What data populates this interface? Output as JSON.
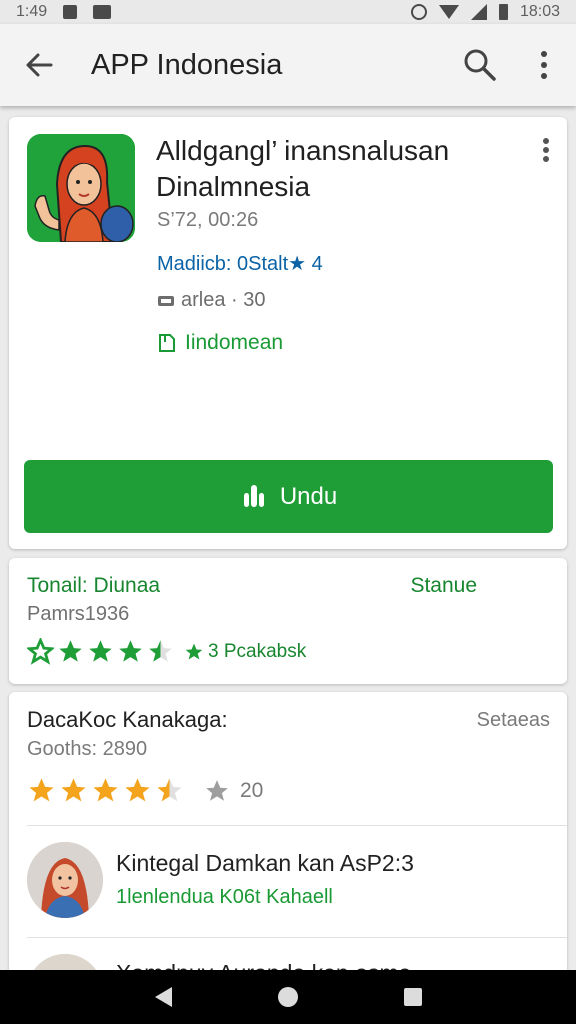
{
  "status_bar": {
    "time_left": "1:49",
    "time_right": "18:03"
  },
  "toolbar": {
    "title": "APP Indonesia"
  },
  "app": {
    "name": "Alldgangl’ inansnalusan Dinalmnesia",
    "meta_size": "S’72, 00:26",
    "meta_developer": "Madiicb: 0Stalt★ 4",
    "meta_category": "arlea · 30",
    "meta_language": "Iindomean",
    "install_label": "Undu",
    "icon_bg": "#1fa33a",
    "accent": "#1f9e38"
  },
  "rating": {
    "title": "Tonail: Diunaa",
    "status": "Stanue",
    "subtitle": "Pamrs1936",
    "stars_value": 4.5,
    "count_label": "3 Pcakabsk",
    "star_color": "#1f9e38"
  },
  "reviews": {
    "title": "DacaKoc Kanakaga:",
    "action": "Setaeas",
    "subtitle": "Gooths: 2890",
    "stars_value": 4.5,
    "count_label": "20",
    "star_color": "#f4a31d",
    "items": [
      {
        "name": "Kintegal Damkan kan AsP2:3",
        "meta": "1lenlendua K06t Kahaell"
      },
      {
        "name": "Xamdnuv Auranda kan asma",
        "meta": ""
      }
    ]
  }
}
